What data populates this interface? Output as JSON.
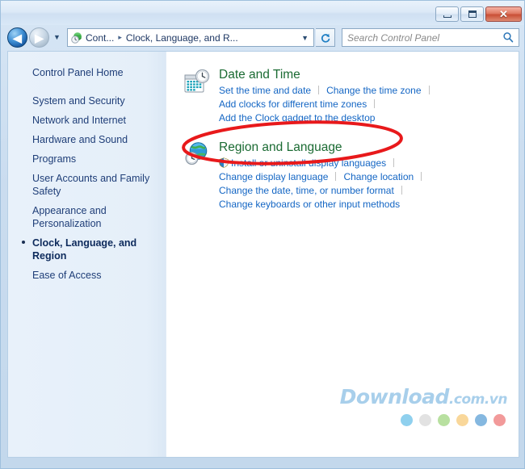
{
  "window": {
    "controls": {
      "minimize_label": "Minimize",
      "maximize_label": "Maximize",
      "close_label": "✕"
    }
  },
  "addressbar": {
    "back_arrow": "◀",
    "forward_arrow": "▶",
    "history_caret": "▼",
    "crumbs": [
      {
        "label": "Cont...",
        "sep": "▸"
      },
      {
        "label": "Clock, Language, and R...",
        "sep": ""
      }
    ],
    "dropdown_caret": "▼",
    "refresh_glyph": "↻"
  },
  "search": {
    "placeholder": "Search Control Panel",
    "value": "",
    "icon": "search-icon",
    "icon_glyph": "⌕"
  },
  "sidebar": {
    "items": [
      {
        "label": "Control Panel Home",
        "active": false,
        "home": true
      },
      {
        "label": "System and Security",
        "active": false,
        "home": false
      },
      {
        "label": "Network and Internet",
        "active": false,
        "home": false
      },
      {
        "label": "Hardware and Sound",
        "active": false,
        "home": false
      },
      {
        "label": "Programs",
        "active": false,
        "home": false
      },
      {
        "label": "User Accounts and Family Safety",
        "active": false,
        "home": false
      },
      {
        "label": "Appearance and Personalization",
        "active": false,
        "home": false
      },
      {
        "label": "Clock, Language, and Region",
        "active": true,
        "home": false
      },
      {
        "label": "Ease of Access",
        "active": false,
        "home": false
      }
    ]
  },
  "categories": [
    {
      "id": "datetime",
      "title": "Date and Time",
      "icon": "calendar-clock-icon",
      "rows": [
        [
          {
            "label": "Set the time and date",
            "shield": false,
            "pipe_after": true
          },
          {
            "label": "Change the time zone",
            "shield": false,
            "pipe_after": true
          }
        ],
        [
          {
            "label": "Add clocks for different time zones",
            "shield": false,
            "pipe_after": true
          }
        ],
        [
          {
            "label": "Add the Clock gadget to the desktop",
            "shield": false,
            "pipe_after": false
          }
        ]
      ]
    },
    {
      "id": "region",
      "title": "Region and Language",
      "icon": "globe-clock-icon",
      "rows": [
        [
          {
            "label": "Install or uninstall display languages",
            "shield": true,
            "pipe_after": true
          }
        ],
        [
          {
            "label": "Change display language",
            "shield": false,
            "pipe_after": true
          },
          {
            "label": "Change location",
            "shield": false,
            "pipe_after": true
          }
        ],
        [
          {
            "label": "Change the date, time, or number format",
            "shield": false,
            "pipe_after": true
          }
        ],
        [
          {
            "label": "Change keyboards or other input methods",
            "shield": false,
            "pipe_after": false
          }
        ]
      ]
    }
  ],
  "annotation": {
    "shape": "ellipse",
    "target": "Region and Language",
    "color": "#e8191b",
    "stroke_width": 4
  },
  "watermark": {
    "brand": "Download",
    "suffix": ".com.vn",
    "color": "#a8cfeb",
    "dots": [
      "#8fd0ee",
      "#e2e2e2",
      "#b8e0a0",
      "#f9d79a",
      "#85b8e0",
      "#f29a9a"
    ]
  },
  "colors": {
    "heading_green": "#1b6b33",
    "link_blue": "#1466c4",
    "sidebar_text": "#1f3e78",
    "accent_red": "#e8191b"
  }
}
